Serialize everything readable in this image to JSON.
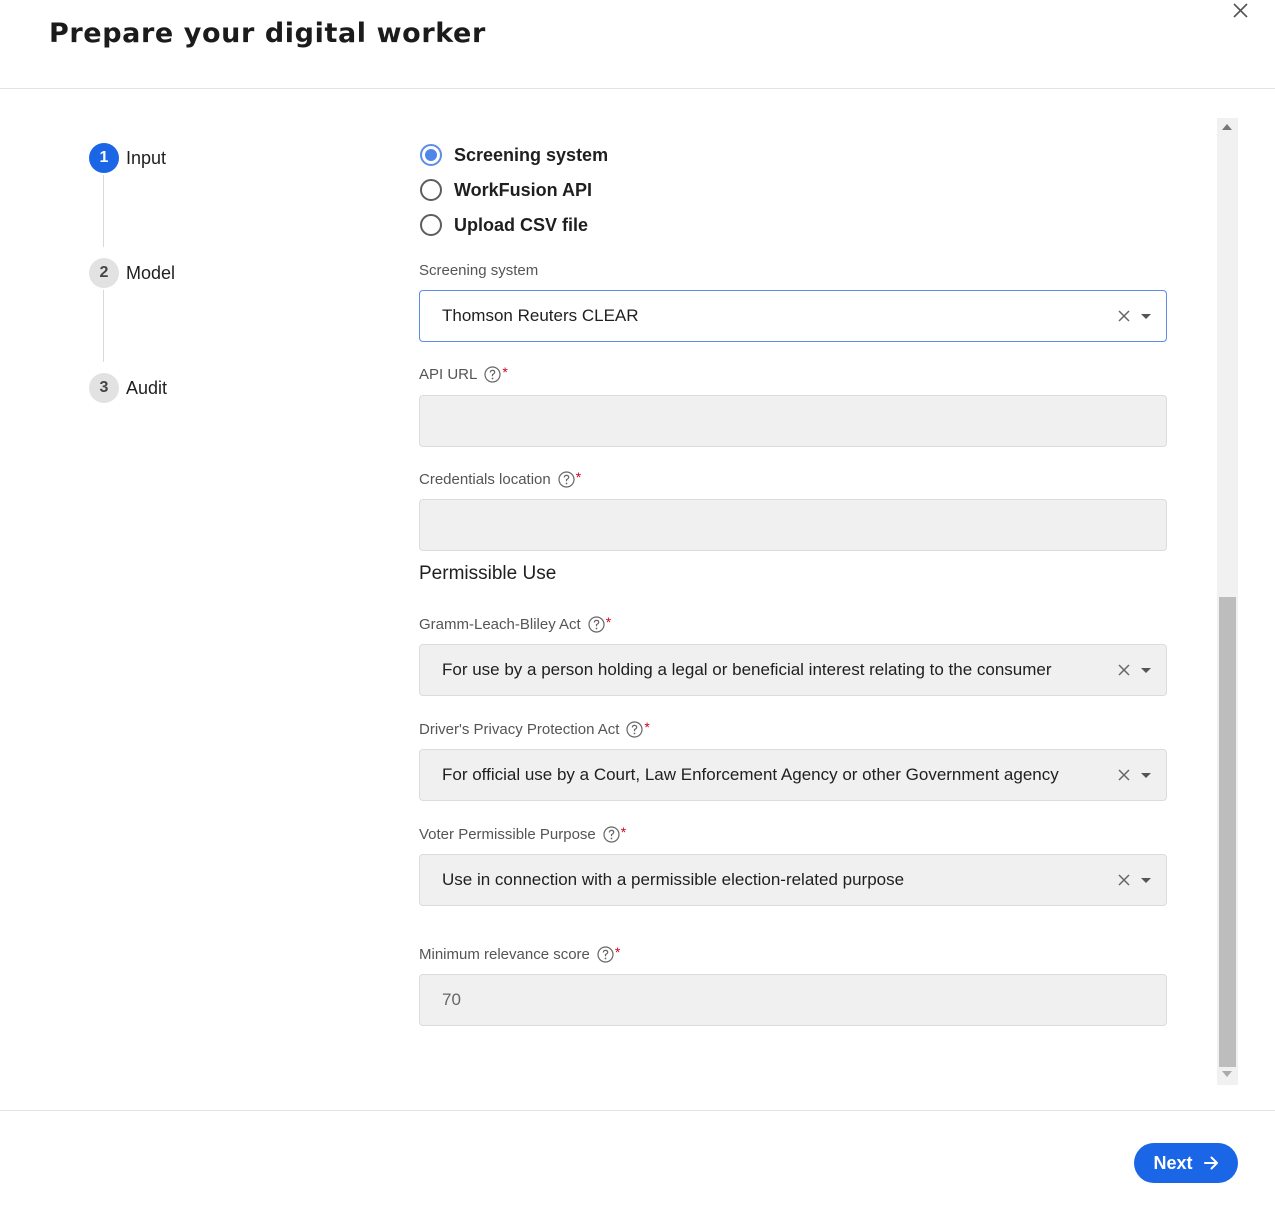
{
  "header": {
    "title": "Prepare your digital worker",
    "close_icon": "close-icon"
  },
  "stepper": {
    "steps": [
      {
        "number": "1",
        "label": "Input",
        "state": "active"
      },
      {
        "number": "2",
        "label": "Model",
        "state": "inactive"
      },
      {
        "number": "3",
        "label": "Audit",
        "state": "inactive"
      }
    ]
  },
  "input_source": {
    "options": [
      {
        "label": "Screening system",
        "checked": true
      },
      {
        "label": "WorkFusion API",
        "checked": false
      },
      {
        "label": "Upload CSV file",
        "checked": false
      }
    ]
  },
  "form": {
    "screening_system": {
      "label": "Screening system",
      "value": "Thomson Reuters CLEAR"
    },
    "api_url": {
      "label": "API URL",
      "required_mark": "*",
      "value": ""
    },
    "credentials_location": {
      "label": "Credentials location",
      "required_mark": "*",
      "value": ""
    },
    "permissible_use_title": "Permissible Use",
    "glba": {
      "label": "Gramm-Leach-Bliley Act",
      "required_mark": "*",
      "value": "For use by a person holding a legal or beneficial interest relating to the consumer"
    },
    "dppa": {
      "label": "Driver's Privacy Protection Act",
      "required_mark": "*",
      "value": "For official use by a Court, Law Enforcement Agency or other Government agency"
    },
    "voter": {
      "label": "Voter Permissible Purpose",
      "required_mark": "*",
      "value": "Use in connection with a permissible election-related purpose"
    },
    "min_score": {
      "label": "Minimum relevance score",
      "required_mark": "*",
      "value": "70"
    }
  },
  "footer": {
    "next_label": "Next"
  },
  "colors": {
    "accent": "#1a66e6",
    "required": "#d0021b"
  }
}
